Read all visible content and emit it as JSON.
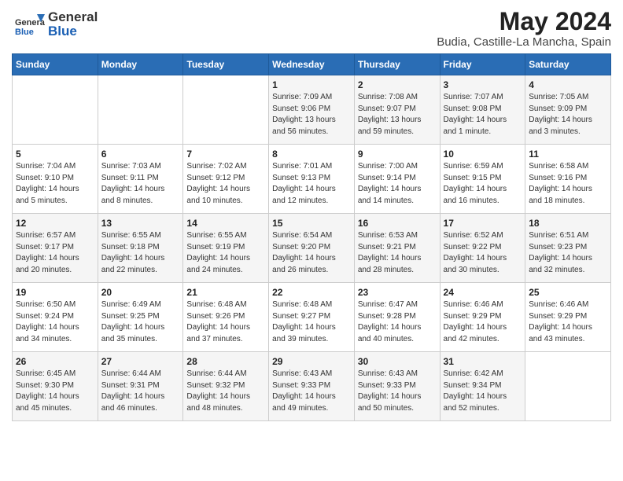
{
  "logo": {
    "general": "General",
    "blue": "Blue"
  },
  "title": "May 2024",
  "subtitle": "Budia, Castille-La Mancha, Spain",
  "days_of_week": [
    "Sunday",
    "Monday",
    "Tuesday",
    "Wednesday",
    "Thursday",
    "Friday",
    "Saturday"
  ],
  "weeks": [
    [
      {
        "day": "",
        "info": ""
      },
      {
        "day": "",
        "info": ""
      },
      {
        "day": "",
        "info": ""
      },
      {
        "day": "1",
        "info": "Sunrise: 7:09 AM\nSunset: 9:06 PM\nDaylight: 13 hours\nand 56 minutes."
      },
      {
        "day": "2",
        "info": "Sunrise: 7:08 AM\nSunset: 9:07 PM\nDaylight: 13 hours\nand 59 minutes."
      },
      {
        "day": "3",
        "info": "Sunrise: 7:07 AM\nSunset: 9:08 PM\nDaylight: 14 hours\nand 1 minute."
      },
      {
        "day": "4",
        "info": "Sunrise: 7:05 AM\nSunset: 9:09 PM\nDaylight: 14 hours\nand 3 minutes."
      }
    ],
    [
      {
        "day": "5",
        "info": "Sunrise: 7:04 AM\nSunset: 9:10 PM\nDaylight: 14 hours\nand 5 minutes."
      },
      {
        "day": "6",
        "info": "Sunrise: 7:03 AM\nSunset: 9:11 PM\nDaylight: 14 hours\nand 8 minutes."
      },
      {
        "day": "7",
        "info": "Sunrise: 7:02 AM\nSunset: 9:12 PM\nDaylight: 14 hours\nand 10 minutes."
      },
      {
        "day": "8",
        "info": "Sunrise: 7:01 AM\nSunset: 9:13 PM\nDaylight: 14 hours\nand 12 minutes."
      },
      {
        "day": "9",
        "info": "Sunrise: 7:00 AM\nSunset: 9:14 PM\nDaylight: 14 hours\nand 14 minutes."
      },
      {
        "day": "10",
        "info": "Sunrise: 6:59 AM\nSunset: 9:15 PM\nDaylight: 14 hours\nand 16 minutes."
      },
      {
        "day": "11",
        "info": "Sunrise: 6:58 AM\nSunset: 9:16 PM\nDaylight: 14 hours\nand 18 minutes."
      }
    ],
    [
      {
        "day": "12",
        "info": "Sunrise: 6:57 AM\nSunset: 9:17 PM\nDaylight: 14 hours\nand 20 minutes."
      },
      {
        "day": "13",
        "info": "Sunrise: 6:55 AM\nSunset: 9:18 PM\nDaylight: 14 hours\nand 22 minutes."
      },
      {
        "day": "14",
        "info": "Sunrise: 6:55 AM\nSunset: 9:19 PM\nDaylight: 14 hours\nand 24 minutes."
      },
      {
        "day": "15",
        "info": "Sunrise: 6:54 AM\nSunset: 9:20 PM\nDaylight: 14 hours\nand 26 minutes."
      },
      {
        "day": "16",
        "info": "Sunrise: 6:53 AM\nSunset: 9:21 PM\nDaylight: 14 hours\nand 28 minutes."
      },
      {
        "day": "17",
        "info": "Sunrise: 6:52 AM\nSunset: 9:22 PM\nDaylight: 14 hours\nand 30 minutes."
      },
      {
        "day": "18",
        "info": "Sunrise: 6:51 AM\nSunset: 9:23 PM\nDaylight: 14 hours\nand 32 minutes."
      }
    ],
    [
      {
        "day": "19",
        "info": "Sunrise: 6:50 AM\nSunset: 9:24 PM\nDaylight: 14 hours\nand 34 minutes."
      },
      {
        "day": "20",
        "info": "Sunrise: 6:49 AM\nSunset: 9:25 PM\nDaylight: 14 hours\nand 35 minutes."
      },
      {
        "day": "21",
        "info": "Sunrise: 6:48 AM\nSunset: 9:26 PM\nDaylight: 14 hours\nand 37 minutes."
      },
      {
        "day": "22",
        "info": "Sunrise: 6:48 AM\nSunset: 9:27 PM\nDaylight: 14 hours\nand 39 minutes."
      },
      {
        "day": "23",
        "info": "Sunrise: 6:47 AM\nSunset: 9:28 PM\nDaylight: 14 hours\nand 40 minutes."
      },
      {
        "day": "24",
        "info": "Sunrise: 6:46 AM\nSunset: 9:29 PM\nDaylight: 14 hours\nand 42 minutes."
      },
      {
        "day": "25",
        "info": "Sunrise: 6:46 AM\nSunset: 9:29 PM\nDaylight: 14 hours\nand 43 minutes."
      }
    ],
    [
      {
        "day": "26",
        "info": "Sunrise: 6:45 AM\nSunset: 9:30 PM\nDaylight: 14 hours\nand 45 minutes."
      },
      {
        "day": "27",
        "info": "Sunrise: 6:44 AM\nSunset: 9:31 PM\nDaylight: 14 hours\nand 46 minutes."
      },
      {
        "day": "28",
        "info": "Sunrise: 6:44 AM\nSunset: 9:32 PM\nDaylight: 14 hours\nand 48 minutes."
      },
      {
        "day": "29",
        "info": "Sunrise: 6:43 AM\nSunset: 9:33 PM\nDaylight: 14 hours\nand 49 minutes."
      },
      {
        "day": "30",
        "info": "Sunrise: 6:43 AM\nSunset: 9:33 PM\nDaylight: 14 hours\nand 50 minutes."
      },
      {
        "day": "31",
        "info": "Sunrise: 6:42 AM\nSunset: 9:34 PM\nDaylight: 14 hours\nand 52 minutes."
      },
      {
        "day": "",
        "info": ""
      }
    ]
  ]
}
